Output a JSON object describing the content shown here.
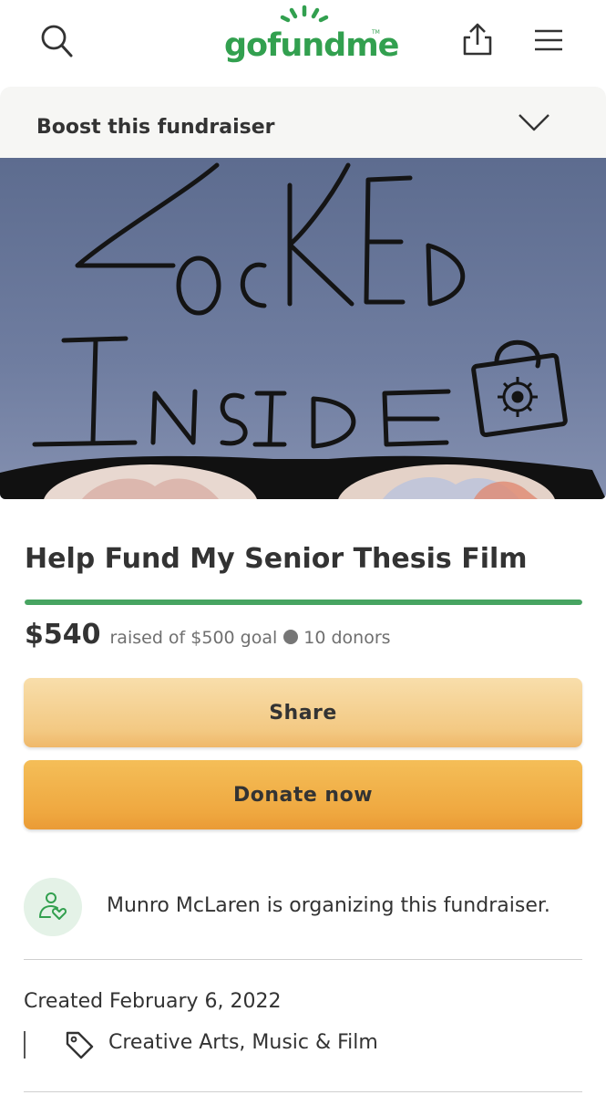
{
  "header": {
    "logo_text": "gofundme",
    "logo_tm": "TM",
    "icons": {
      "search": "search-icon",
      "share": "upload-share-icon",
      "menu": "hamburger-menu-icon"
    }
  },
  "boost": {
    "label": "Boost this fundraiser",
    "icon": "chevron-down-icon"
  },
  "hero": {
    "image_title_line1": "LocKED",
    "image_title_line2": "INSIDE",
    "image_icon": "padlock-virus-icon"
  },
  "campaign": {
    "title": "Help Fund My Senior Thesis Film",
    "amount_raised": "$540",
    "goal_text": "raised of $500 goal",
    "donors_text": "10 donors",
    "progress_fraction": 1.0,
    "progress_color": "#47a461"
  },
  "buttons": {
    "share_label": "Share",
    "donate_label": "Donate now"
  },
  "organizer": {
    "text": "Munro McLaren is organizing this fundraiser.",
    "icon": "person-heart-icon"
  },
  "details": {
    "created": "Created February 6, 2022",
    "category": "Creative Arts, Music & Film",
    "category_icon": "tag-icon"
  },
  "colors": {
    "brand_green": "#32a04f",
    "share_button": "#f3c983",
    "donate_button": "#efa840"
  }
}
